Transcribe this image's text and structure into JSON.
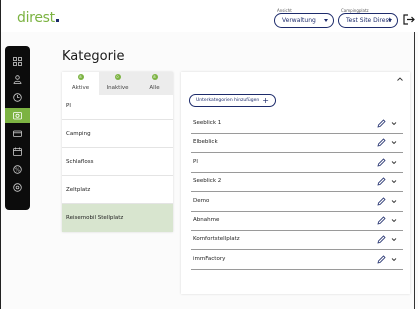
{
  "header": {
    "logo": "direst",
    "ansicht_label": "Ansicht",
    "ansicht_value": "Verwaltung",
    "campingplatz_label": "Campingplatz",
    "campingplatz_value": "Test Site Direst",
    "logout_icon": "logout-icon"
  },
  "sidebar": {
    "items": [
      {
        "icon": "grid-icon"
      },
      {
        "icon": "person-icon"
      },
      {
        "icon": "clock-icon"
      },
      {
        "icon": "camera-icon",
        "active": true
      },
      {
        "icon": "card-icon"
      },
      {
        "icon": "calendar-icon"
      },
      {
        "icon": "tag-icon"
      },
      {
        "icon": "gear-icon"
      }
    ]
  },
  "page": {
    "title": "Kategorie"
  },
  "categories": {
    "tabs": [
      {
        "label": "Aktive",
        "count": "8"
      },
      {
        "label": "Inaktive",
        "count": "0"
      },
      {
        "label": "Alle",
        "count": "8"
      }
    ],
    "items": [
      {
        "label": "Pl"
      },
      {
        "label": "Camping"
      },
      {
        "label": "Schlafloss"
      },
      {
        "label": "Zeltplatz"
      },
      {
        "label": "Reisemobil Stellplatz"
      }
    ],
    "selected_index": 4
  },
  "subcategories": {
    "add_button_label": "Unterkategorien hinzufügen",
    "rows": [
      {
        "label": "Seeblick 1"
      },
      {
        "label": "Elbeblick"
      },
      {
        "label": "Pl"
      },
      {
        "label": "Seeblick 2"
      },
      {
        "label": "Demo"
      },
      {
        "label": "Abnahme"
      },
      {
        "label": "Komfortstellplatz"
      },
      {
        "label": "immFactory"
      }
    ]
  },
  "colors": {
    "accent": "#7cb342",
    "navy": "#1d2b6b",
    "selected_row": "#d8e5cf"
  }
}
